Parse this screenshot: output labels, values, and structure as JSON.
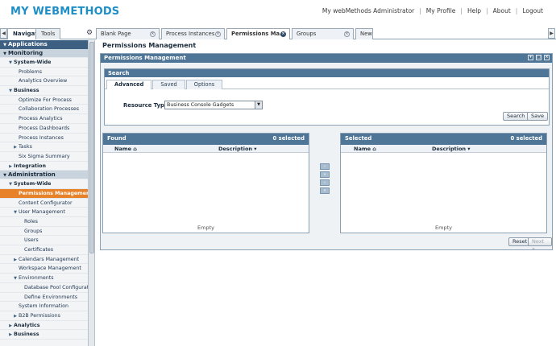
{
  "app": {
    "logo": "MY WEBMETHODS",
    "top_links": [
      "My webMethods Administrator",
      "My Profile",
      "Help",
      "About",
      "Logout"
    ]
  },
  "left_tabs": [
    "Navigate",
    "Tools"
  ],
  "main_tabs": [
    {
      "label": "Blank Page"
    },
    {
      "label": "Process Instances"
    },
    {
      "label": "Permissions Ma..."
    },
    {
      "label": "Groups"
    },
    {
      "label": "New"
    }
  ],
  "nav": {
    "header": "Applications",
    "monitoring": {
      "label": "Monitoring",
      "system_wide": "System-Wide",
      "system_items": [
        "Problems",
        "Analytics Overview"
      ],
      "business": "Business",
      "business_items": [
        "Optimize For Process",
        "Collaboration Processes",
        "Process Analytics",
        "Process Dashboards",
        "Process Instances",
        "Tasks",
        "Six Sigma Summary"
      ],
      "integration": "Integration"
    },
    "administration": {
      "label": "Administration",
      "system_wide": "System-Wide",
      "permissions": "Permissions Management",
      "content": "Content Configurator",
      "user_mgmt": "User Management",
      "user_items": [
        "Roles",
        "Groups",
        "Users",
        "Certificates"
      ],
      "calendars": "Calendars Management",
      "workspace": "Workspace Management",
      "environments": "Environments",
      "env_items": [
        "Database Pool Configuration",
        "Define Environments"
      ],
      "sysinfo": "System Information",
      "b2b": "B2B Permissions"
    },
    "analytics": "Analytics",
    "business_cut": "Business"
  },
  "page": {
    "title": "Permissions Management",
    "portlet_title": "Permissions Management",
    "search": {
      "title": "Search",
      "tabs": [
        "Advanced",
        "Saved",
        "Options"
      ],
      "resource_label": "Resource Type:",
      "resource_value": "Business Console Gadgets",
      "search_btn": "Search",
      "save_btn": "Save"
    },
    "found": {
      "title": "Found",
      "count": "0 selected",
      "col_name": "Name ⌂",
      "col_desc": "Description ▾",
      "empty": "Empty"
    },
    "selected": {
      "title": "Selected",
      "count": "0 selected",
      "col_name": "Name ⌂",
      "col_desc": "Description ▾",
      "empty": "Empty"
    },
    "reset_btn": "Reset",
    "next_btn": "Next »"
  }
}
